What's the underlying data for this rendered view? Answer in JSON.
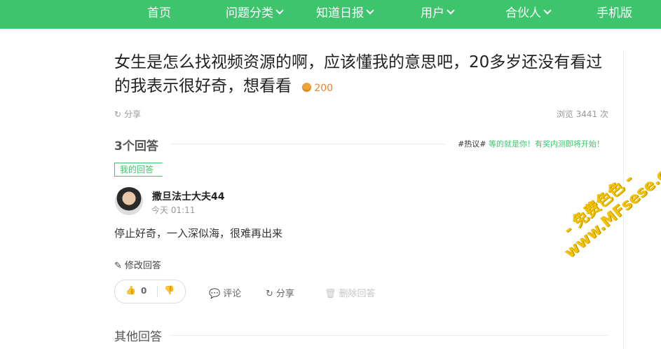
{
  "nav": {
    "items": [
      {
        "label": "首页",
        "has_dropdown": false
      },
      {
        "label": "问题分类",
        "has_dropdown": true
      },
      {
        "label": "知道日报",
        "has_dropdown": true
      },
      {
        "label": "用户",
        "has_dropdown": true
      },
      {
        "label": "合伙人",
        "has_dropdown": true
      },
      {
        "label": "手机版",
        "has_dropdown": false
      }
    ]
  },
  "question": {
    "title": "女生是怎么找视频资源的啊，应该懂我的意思吧，20多岁还没有看过的我表示很好奇，想看看",
    "reward": "200",
    "share_label": "分享",
    "views_label": "浏览 3441 次"
  },
  "answers": {
    "count_label": "3个回答",
    "hot_tag": "#热议#",
    "hot_text": "等的就是你！有奖内测即将开始！",
    "my_answer_tag": "我的回答",
    "user_name": "撒旦法士大夫44",
    "time": "今天 01:11",
    "content": "停止好奇，一入深似海，很难再出来",
    "edit_label": "修改回答",
    "upvotes": "0",
    "comment_label": "评论",
    "share_label": "分享",
    "delete_label": "删除回答",
    "other_label": "其他回答"
  },
  "watermark": {
    "line1": "- 免费色色 -",
    "line2": "www.MFsese.com"
  },
  "colors": {
    "brand": "#3ec46d",
    "reward": "#e8842f",
    "watermark": "#f5c400"
  }
}
